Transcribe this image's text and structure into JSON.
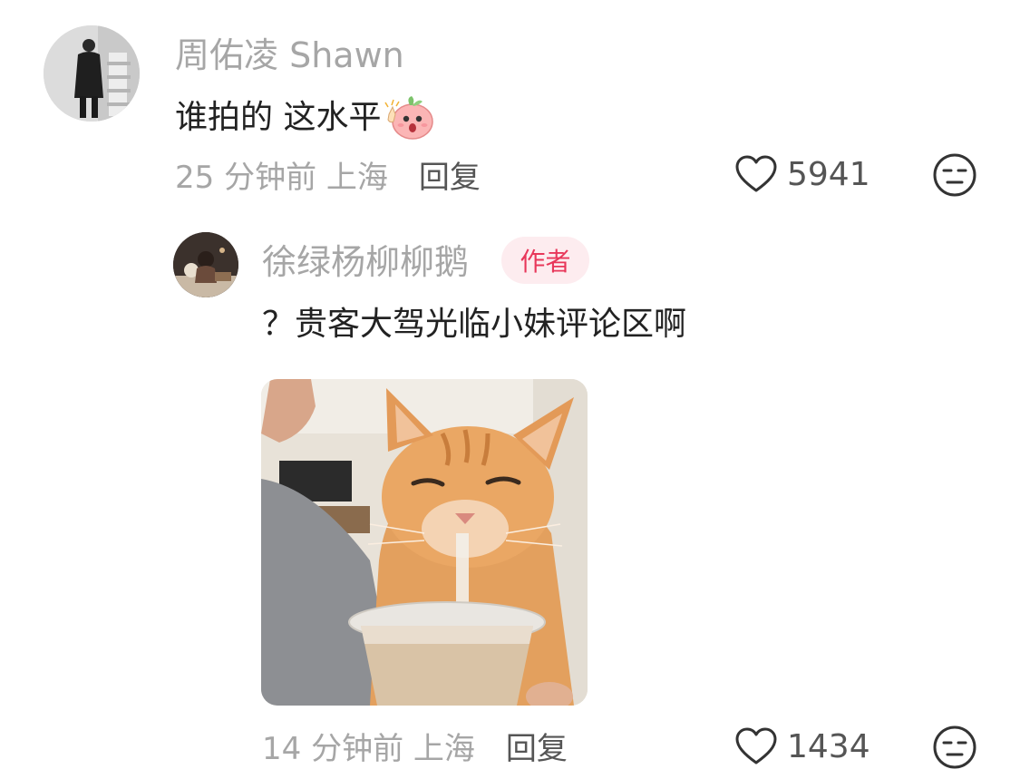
{
  "comments": [
    {
      "username": "周佑凌 Shawn",
      "text": "谁拍的 这水平",
      "emoji_icon": "shocked-peach-emoji",
      "time_location": "25 分钟前 上海",
      "reply_label": "回复",
      "like_count": "5941"
    },
    {
      "username": "徐绿杨柳柳鹅",
      "badge": "作者",
      "text": "？贵客大驾光临小妹评论区啊",
      "image": "orange-cat-drinking-milk-tea-photo",
      "time_location": "14 分钟前 上海",
      "reply_label": "回复",
      "like_count": "1434"
    }
  ],
  "colors": {
    "username": "#a6a6a6",
    "text": "#222222",
    "badge_bg": "#fdecef",
    "badge_text": "#e8375a"
  },
  "icons": [
    "heart-outline-icon",
    "unimpressed-face-icon"
  ]
}
